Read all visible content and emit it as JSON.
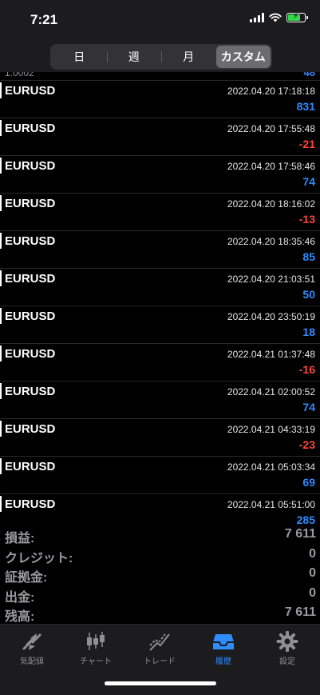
{
  "status_bar": {
    "time": "7:21"
  },
  "period_tabs": [
    {
      "label": "日",
      "active": false
    },
    {
      "label": "週",
      "active": false
    },
    {
      "label": "月",
      "active": false
    },
    {
      "label": "カスタム",
      "active": true
    }
  ],
  "partial_row": {
    "left": "1.0002",
    "right": "48"
  },
  "trades": [
    {
      "symbol": "EURUSD",
      "time": "2022.04.20 17:18:18",
      "profit": "831"
    },
    {
      "symbol": "EURUSD",
      "time": "2022.04.20 17:55:48",
      "profit": "-21"
    },
    {
      "symbol": "EURUSD",
      "time": "2022.04.20 17:58:46",
      "profit": "74"
    },
    {
      "symbol": "EURUSD",
      "time": "2022.04.20 18:16:02",
      "profit": "-13"
    },
    {
      "symbol": "EURUSD",
      "time": "2022.04.20 18:35:46",
      "profit": "85"
    },
    {
      "symbol": "EURUSD",
      "time": "2022.04.20 21:03:51",
      "profit": "50"
    },
    {
      "symbol": "EURUSD",
      "time": "2022.04.20 23:50:19",
      "profit": "18"
    },
    {
      "symbol": "EURUSD",
      "time": "2022.04.21 01:37:48",
      "profit": "-16"
    },
    {
      "symbol": "EURUSD",
      "time": "2022.04.21 02:00:52",
      "profit": "74"
    },
    {
      "symbol": "EURUSD",
      "time": "2022.04.21 04:33:19",
      "profit": "-23"
    },
    {
      "symbol": "EURUSD",
      "time": "2022.04.21 05:03:34",
      "profit": "69"
    },
    {
      "symbol": "EURUSD",
      "time": "2022.04.21 05:51:00",
      "profit": "285"
    }
  ],
  "summary": [
    {
      "label": "損益:",
      "value": "7 611"
    },
    {
      "label": "クレジット:",
      "value": "0"
    },
    {
      "label": "証拠金:",
      "value": "0"
    },
    {
      "label": "出金:",
      "value": "0"
    },
    {
      "label": "残高:",
      "value": "7 611"
    }
  ],
  "tab_bar": [
    {
      "label": "気配値",
      "icon": "quotes-icon",
      "active": false
    },
    {
      "label": "チャート",
      "icon": "chart-candles-icon",
      "active": false
    },
    {
      "label": "トレード",
      "icon": "trade-icon",
      "active": false
    },
    {
      "label": "履歴",
      "icon": "history-inbox-icon",
      "active": true
    },
    {
      "label": "設定",
      "icon": "gear-icon",
      "active": false
    }
  ],
  "colors": {
    "positive": "#2d8cff",
    "negative": "#ff453a",
    "accent": "#2d8cff"
  }
}
